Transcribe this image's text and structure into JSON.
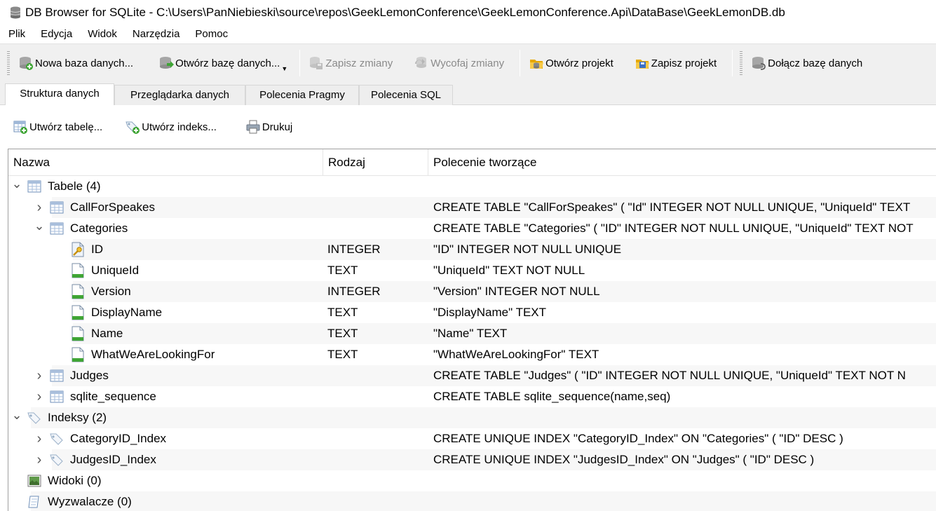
{
  "window": {
    "title": "DB Browser for SQLite - C:\\Users\\PanNiebieski\\source\\repos\\GeekLemonConference\\GeekLemonConference.Api\\DataBase\\GeekLemonDB.db"
  },
  "menu": [
    "Plik",
    "Edycja",
    "Widok",
    "Narzędzia",
    "Pomoc"
  ],
  "toolbar": {
    "new_db": "Nowa baza danych...",
    "open_db": "Otwórz bazę danych...",
    "write_changes": "Zapisz zmiany",
    "revert_changes": "Wycofaj zmiany",
    "open_project": "Otwórz projekt",
    "save_project": "Zapisz projekt",
    "attach_db": "Dołącz bazę danych"
  },
  "tabs": [
    "Struktura danych",
    "Przeglądarka danych",
    "Polecenia Pragmy",
    "Polecenia SQL"
  ],
  "active_tab": "Struktura danych",
  "subtoolbar": {
    "create_table": "Utwórz tabelę...",
    "create_index": "Utwórz indeks...",
    "print": "Drukuj"
  },
  "tree": {
    "headers": {
      "name": "Nazwa",
      "type": "Rodzaj",
      "schema": "Polecenie tworzące"
    },
    "rows": [
      {
        "level": 0,
        "arrow": "expanded",
        "icon": "table-icon",
        "name": "Tabele (4)",
        "type": "",
        "schema": ""
      },
      {
        "level": 1,
        "arrow": "collapsed",
        "icon": "table-icon",
        "name": "CallForSpeakes",
        "type": "",
        "schema": "CREATE TABLE \"CallForSpeakes\" ( \"Id\" INTEGER NOT NULL UNIQUE, \"UniqueId\" TEXT"
      },
      {
        "level": 1,
        "arrow": "expanded",
        "icon": "table-icon",
        "name": "Categories",
        "type": "",
        "schema": "CREATE TABLE \"Categories\" ( \"ID\" INTEGER NOT NULL UNIQUE, \"UniqueId\" TEXT NOT"
      },
      {
        "level": 2,
        "arrow": "",
        "icon": "key-field-icon",
        "name": "ID",
        "type": "INTEGER",
        "schema": "\"ID\" INTEGER NOT NULL UNIQUE"
      },
      {
        "level": 2,
        "arrow": "",
        "icon": "field-icon",
        "name": "UniqueId",
        "type": "TEXT",
        "schema": "\"UniqueId\" TEXT NOT NULL"
      },
      {
        "level": 2,
        "arrow": "",
        "icon": "field-icon",
        "name": "Version",
        "type": "INTEGER",
        "schema": "\"Version\" INTEGER NOT NULL"
      },
      {
        "level": 2,
        "arrow": "",
        "icon": "field-icon",
        "name": "DisplayName",
        "type": "TEXT",
        "schema": "\"DisplayName\" TEXT"
      },
      {
        "level": 2,
        "arrow": "",
        "icon": "field-icon",
        "name": "Name",
        "type": "TEXT",
        "schema": "\"Name\" TEXT"
      },
      {
        "level": 2,
        "arrow": "",
        "icon": "field-icon",
        "name": "WhatWeAreLookingFor",
        "type": "TEXT",
        "schema": "\"WhatWeAreLookingFor\" TEXT"
      },
      {
        "level": 1,
        "arrow": "collapsed",
        "icon": "table-icon",
        "name": "Judges",
        "type": "",
        "schema": "CREATE TABLE \"Judges\" ( \"ID\" INTEGER NOT NULL UNIQUE, \"UniqueId\" TEXT NOT N"
      },
      {
        "level": 1,
        "arrow": "collapsed",
        "icon": "table-icon",
        "name": "sqlite_sequence",
        "type": "",
        "schema": "CREATE TABLE sqlite_sequence(name,seq)"
      },
      {
        "level": 0,
        "arrow": "expanded",
        "icon": "index-icon",
        "name": "Indeksy (2)",
        "type": "",
        "schema": ""
      },
      {
        "level": 1,
        "arrow": "collapsed",
        "icon": "index-icon",
        "name": "CategoryID_Index",
        "type": "",
        "schema": "CREATE UNIQUE INDEX \"CategoryID_Index\" ON \"Categories\" ( \"ID\" DESC )"
      },
      {
        "level": 1,
        "arrow": "collapsed",
        "icon": "index-icon",
        "name": "JudgesID_Index",
        "type": "",
        "schema": "CREATE UNIQUE INDEX \"JudgesID_Index\" ON \"Judges\" ( \"ID\" DESC )"
      },
      {
        "level": 0,
        "arrow": "",
        "icon": "view-icon",
        "name": "Widoki (0)",
        "type": "",
        "schema": ""
      },
      {
        "level": 0,
        "arrow": "",
        "icon": "trigger-icon",
        "name": "Wyzwalacze (0)",
        "type": "",
        "schema": ""
      }
    ]
  }
}
